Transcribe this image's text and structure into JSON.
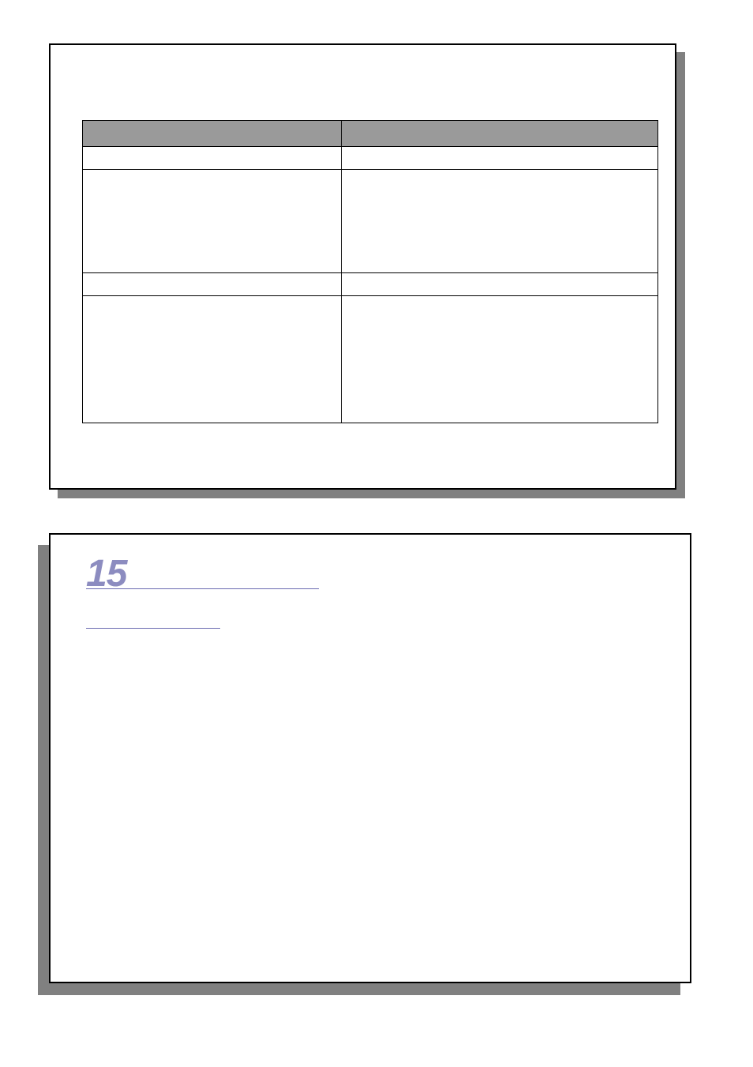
{
  "top_card": {
    "table": {
      "header_row": [
        "",
        ""
      ],
      "sub_row_1": [
        "",
        ""
      ],
      "body_row_1": [
        "",
        ""
      ],
      "sub_row_2": [
        "",
        ""
      ],
      "body_row_2": [
        "",
        ""
      ]
    }
  },
  "bottom_card": {
    "heading_number": "15",
    "heading_text": "",
    "subheading_text": ""
  }
}
